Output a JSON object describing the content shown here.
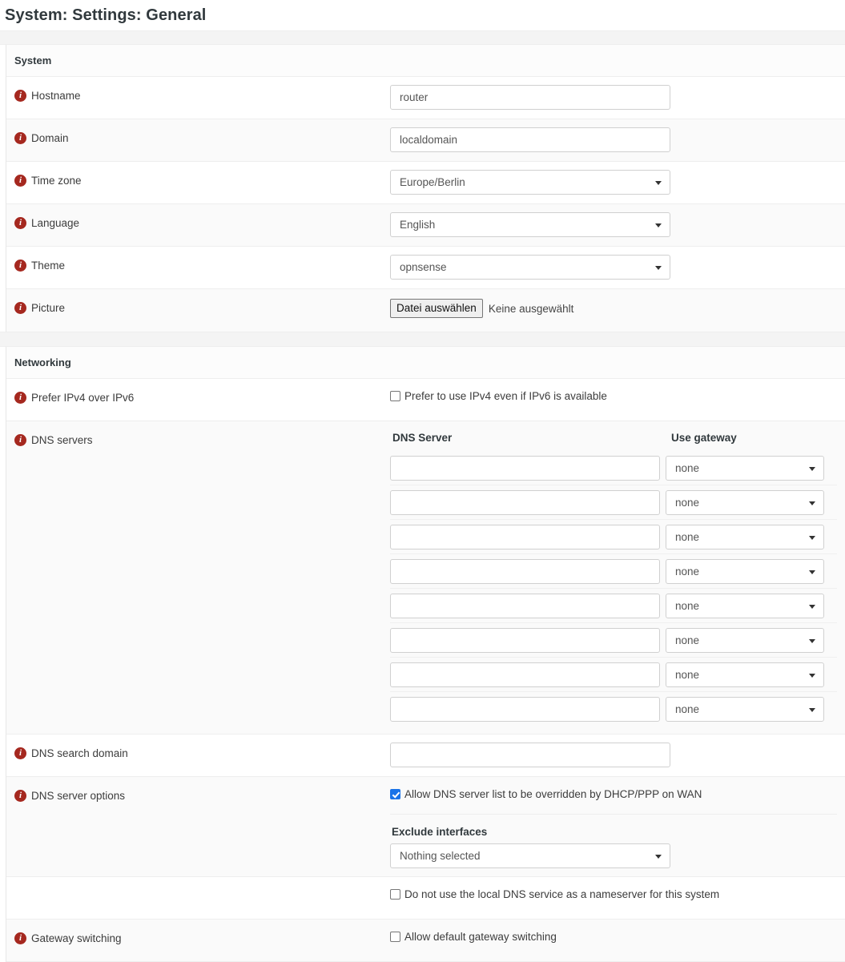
{
  "page": {
    "title": "System: Settings: General"
  },
  "icons": {
    "info": "i",
    "info_name": "info-icon",
    "caret": "chevron-down-icon"
  },
  "colors": {
    "info_icon_bg": "#a5281f",
    "checkbox_checked": "#1a73e8",
    "row_alt_bg": "#fafafa",
    "band_bg": "#f4f4f4",
    "border": "#eeeeee",
    "text": "#3c3c3c"
  },
  "sections": [
    {
      "id": "system",
      "header": "System",
      "rows": [
        {
          "label": "Hostname",
          "type": "text",
          "value": "router",
          "placeholder": ""
        },
        {
          "label": "Domain",
          "type": "text",
          "value": "localdomain",
          "placeholder": ""
        },
        {
          "label": "Time zone",
          "type": "select",
          "value": "Europe/Berlin"
        },
        {
          "label": "Language",
          "type": "select",
          "value": "English"
        },
        {
          "label": "Theme",
          "type": "select",
          "value": "opnsense"
        },
        {
          "label": "Picture",
          "type": "file",
          "button_label": "Datei auswählen",
          "file_status": "Keine ausgewählt"
        }
      ]
    },
    {
      "id": "networking",
      "header": "Networking",
      "rows": [
        {
          "label": "Prefer IPv4 over IPv6",
          "type": "checkbox",
          "checkbox_label": "Prefer to use IPv4 even if IPv6 is available",
          "checked": false
        },
        {
          "label": "DNS servers",
          "type": "dns-table",
          "columns": [
            "DNS Server",
            "Use gateway"
          ],
          "rows": [
            {
              "server": "",
              "gateway": "none"
            },
            {
              "server": "",
              "gateway": "none"
            },
            {
              "server": "",
              "gateway": "none"
            },
            {
              "server": "",
              "gateway": "none"
            },
            {
              "server": "",
              "gateway": "none"
            },
            {
              "server": "",
              "gateway": "none"
            },
            {
              "server": "",
              "gateway": "none"
            },
            {
              "server": "",
              "gateway": "none"
            }
          ]
        },
        {
          "label": "DNS search domain",
          "type": "text",
          "value": "",
          "placeholder": ""
        },
        {
          "label": "DNS server options",
          "type": "dns-options",
          "override_label": "Allow DNS server list to be overridden by DHCP/PPP on WAN",
          "override_checked": true,
          "exclude_title": "Exclude interfaces",
          "exclude_value": "Nothing selected"
        },
        {
          "label": "",
          "type": "checkbox",
          "checkbox_label": "Do not use the local DNS service as a nameserver for this system",
          "checked": false
        },
        {
          "label": "Gateway switching",
          "type": "checkbox",
          "checkbox_label": "Allow default gateway switching",
          "checked": false
        }
      ]
    }
  ]
}
